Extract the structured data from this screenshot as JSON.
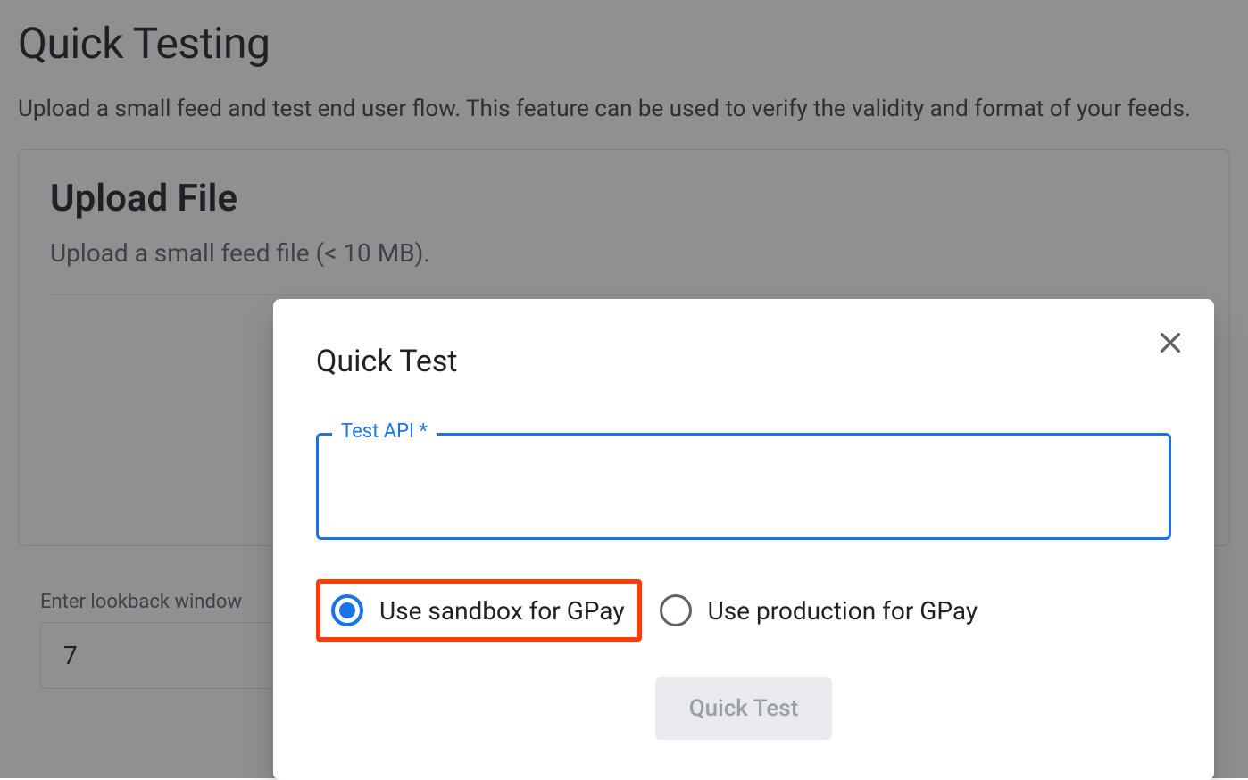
{
  "page": {
    "title": "Quick Testing",
    "subtitle": "Upload a small feed and test end user flow. This feature can be used to verify the validity and format of your feeds."
  },
  "upload": {
    "title": "Upload File",
    "subtitle": "Upload a small feed file (< 10 MB)."
  },
  "lookback": {
    "label": "Enter lookback window",
    "value": "7"
  },
  "dialog": {
    "title": "Quick Test",
    "input_label": "Test API *",
    "input_value": "",
    "radio": {
      "sandbox": "Use sandbox for GPay",
      "production": "Use production for GPay"
    },
    "button_label": "Quick Test"
  }
}
